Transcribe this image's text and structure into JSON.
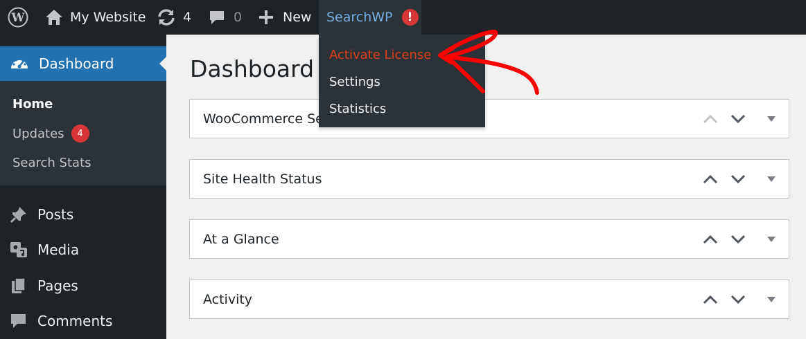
{
  "adminbar": {
    "site_name": "My Website",
    "updates_count": "4",
    "comments_count": "0",
    "new_label": "New",
    "plugin_label": "SearchWP",
    "alert_glyph": "!"
  },
  "dropdown": {
    "items": [
      {
        "label": "Activate License",
        "active": true
      },
      {
        "label": "Settings"
      },
      {
        "label": "Statistics"
      }
    ]
  },
  "sidebar": {
    "dashboard_label": "Dashboard",
    "submenu": {
      "home": "Home",
      "updates": "Updates",
      "updates_badge": "4",
      "search_stats": "Search Stats"
    },
    "items": [
      {
        "label": "Posts",
        "icon": "pin-icon"
      },
      {
        "label": "Media",
        "icon": "media-icon"
      },
      {
        "label": "Pages",
        "icon": "pages-icon"
      },
      {
        "label": "Comments",
        "icon": "comment-icon"
      }
    ]
  },
  "main": {
    "title": "Dashboard",
    "widgets": [
      {
        "title": "WooCommerce Se"
      },
      {
        "title": "Site Health Status"
      },
      {
        "title": "At a Glance"
      },
      {
        "title": "Activity"
      }
    ]
  },
  "colors": {
    "adminbar_bg": "#1d2327",
    "accent_blue": "#2271b1",
    "link_blue": "#72aee6",
    "alert_red": "#d63638",
    "active_orange": "#dc3e1f",
    "annotation_red": "#ff0000"
  }
}
